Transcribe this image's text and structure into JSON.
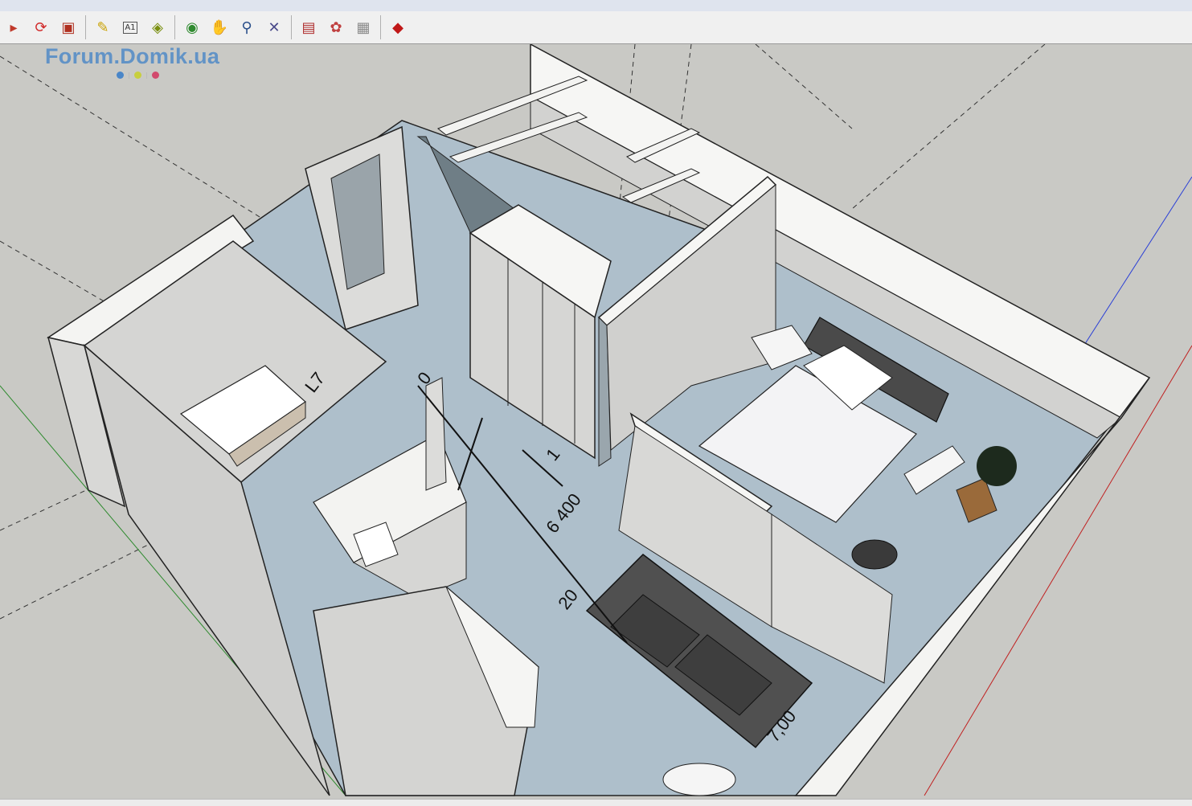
{
  "watermark": {
    "text": "Forum.Domik.ua",
    "dot_colors": [
      "#4a86c8",
      "#c8cf3e",
      "#d24a6d"
    ]
  },
  "toolbar": {
    "groups": [
      [
        {
          "name": "arrow-tool-icon",
          "glyph": "▸",
          "color": "#c0392b"
        },
        {
          "name": "orbit-refresh-icon",
          "glyph": "⟳",
          "color": "#d12b2b"
        },
        {
          "name": "export-icon",
          "glyph": "▣",
          "color": "#b03020"
        }
      ],
      [
        {
          "name": "tape-measure-icon",
          "glyph": "✎",
          "color": "#c9a100"
        },
        {
          "name": "text-label-icon",
          "glyph": "A1",
          "color": "#333333"
        },
        {
          "name": "paint-bucket-icon",
          "glyph": "◈",
          "color": "#7a8f10"
        }
      ],
      [
        {
          "name": "orbit-icon",
          "glyph": "◉",
          "color": "#2f8a2f"
        },
        {
          "name": "pan-hand-icon",
          "glyph": "✋",
          "color": "#d4a040"
        },
        {
          "name": "zoom-icon",
          "glyph": "⚲",
          "color": "#2a4f8a"
        },
        {
          "name": "zoom-extents-icon",
          "glyph": "✕",
          "color": "#4a4a8a"
        }
      ],
      [
        {
          "name": "components-icon",
          "glyph": "▤",
          "color": "#b03030"
        },
        {
          "name": "materials-icon",
          "glyph": "✿",
          "color": "#c04040"
        },
        {
          "name": "styles-icon",
          "glyph": "▦",
          "color": "#8a8a8a"
        }
      ],
      [
        {
          "name": "ruby-console-icon",
          "glyph": "◆",
          "color": "#c01818"
        }
      ]
    ]
  },
  "dimensions": {
    "main": "6 400",
    "small_a": "20",
    "small_b": "1",
    "small_c": "7,00",
    "small_d": "0",
    "small_e": "L7"
  }
}
